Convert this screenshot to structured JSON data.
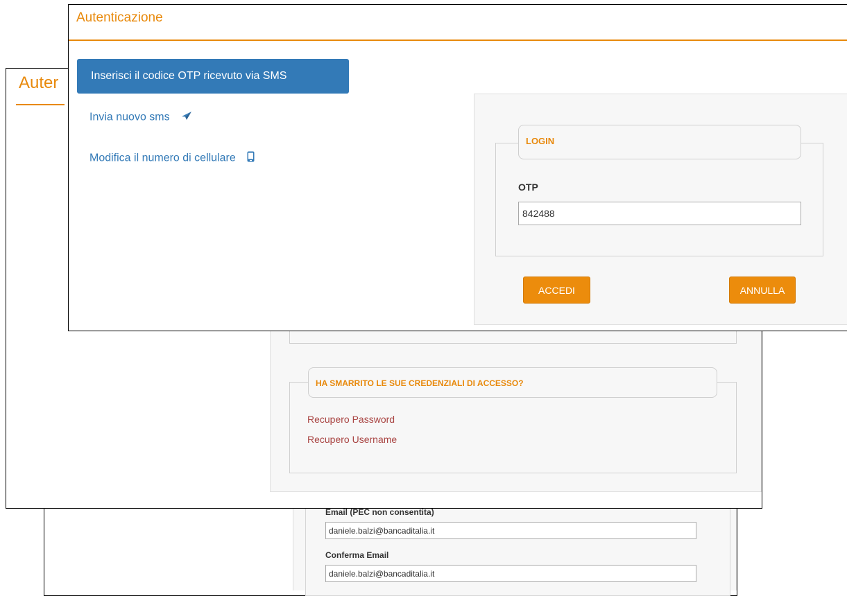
{
  "registration": {
    "email_label": "Email (PEC non consentita)",
    "email_value": "daniele.balzi@bancaditalia.it",
    "confirm_email_label": "Conferma Email",
    "confirm_email_value": "daniele.balzi@bancaditalia.it"
  },
  "auth_window_back": {
    "title": "Auter",
    "recovery_legend": "HA SMARRITO LE SUE CREDENZIALI DI ACCESSO?",
    "recover_password": "Recupero Password",
    "recover_username": "Recupero Username"
  },
  "otp_window": {
    "title": "Autenticazione",
    "otp_sms_button": "Inserisci il codice OTP ricevuto via SMS",
    "send_new_sms": "Invia nuovo sms",
    "change_number": "Modifica il numero di cellulare",
    "login_legend": "LOGIN",
    "otp_label": "OTP",
    "otp_value": "842488",
    "accedi_label": "ACCEDI",
    "annulla_label": "ANNULLA"
  },
  "colors": {
    "accent_orange": "#e8890b",
    "primary_blue": "#337ab7",
    "link_red": "#a94442"
  }
}
